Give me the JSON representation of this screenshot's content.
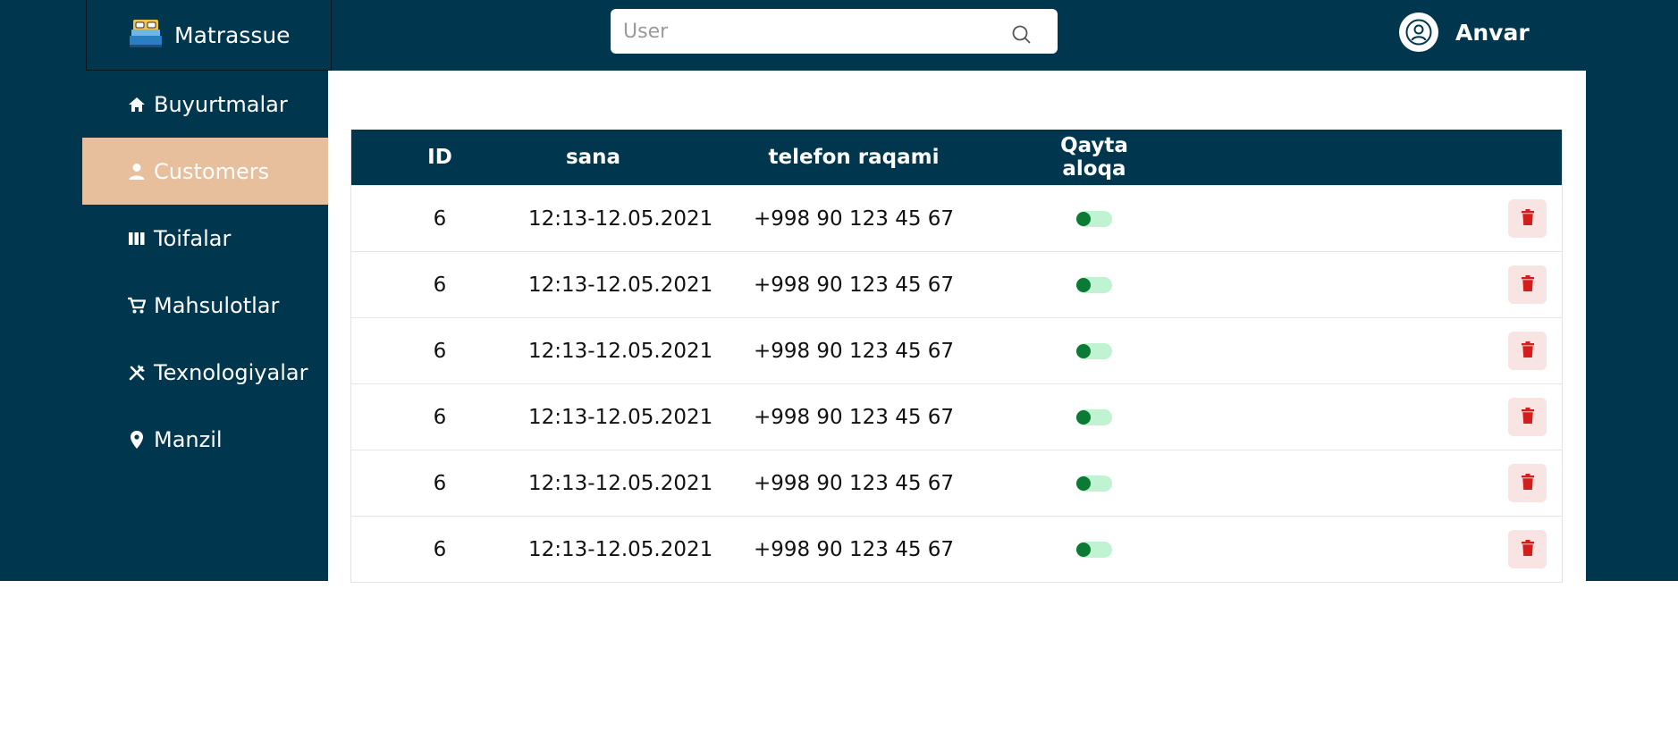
{
  "app": {
    "name": "Matrassue",
    "logo_icon": "bed-icon"
  },
  "search": {
    "placeholder": "User",
    "value": ""
  },
  "user": {
    "name": "Anvar"
  },
  "colors": {
    "primary": "#01374e",
    "active_nav": "#e8bf9d",
    "toggle_track": "#bff3d2",
    "toggle_knob": "#0a7a34",
    "delete_bg": "#f9e4e4",
    "delete_icon": "#d41e1e"
  },
  "sidebar": {
    "items": [
      {
        "label": "Buyurtmalar",
        "icon": "home-icon"
      },
      {
        "label": "Customers",
        "icon": "person-icon",
        "active": true
      },
      {
        "label": "Toifalar",
        "icon": "columns-icon"
      },
      {
        "label": "Mahsulotlar",
        "icon": "cart-icon"
      },
      {
        "label": "Texnologiyalar",
        "icon": "tools-icon"
      },
      {
        "label": "Manzil",
        "icon": "location-pin-icon"
      }
    ]
  },
  "table": {
    "headers": {
      "id": "ID",
      "date": "sana",
      "phone": "telefon raqami",
      "callback": "Qayta aloqa"
    },
    "rows": [
      {
        "id": "6",
        "date": "12:13-12.05.2021",
        "phone": "+998 90 123 45 67",
        "callback": false
      },
      {
        "id": "6",
        "date": "12:13-12.05.2021",
        "phone": "+998 90 123 45 67",
        "callback": false
      },
      {
        "id": "6",
        "date": "12:13-12.05.2021",
        "phone": "+998 90 123 45 67",
        "callback": false
      },
      {
        "id": "6",
        "date": "12:13-12.05.2021",
        "phone": "+998 90 123 45 67",
        "callback": false
      },
      {
        "id": "6",
        "date": "12:13-12.05.2021",
        "phone": "+998 90 123 45 67",
        "callback": false
      },
      {
        "id": "6",
        "date": "12:13-12.05.2021",
        "phone": "+998 90 123 45 67",
        "callback": false
      }
    ]
  }
}
